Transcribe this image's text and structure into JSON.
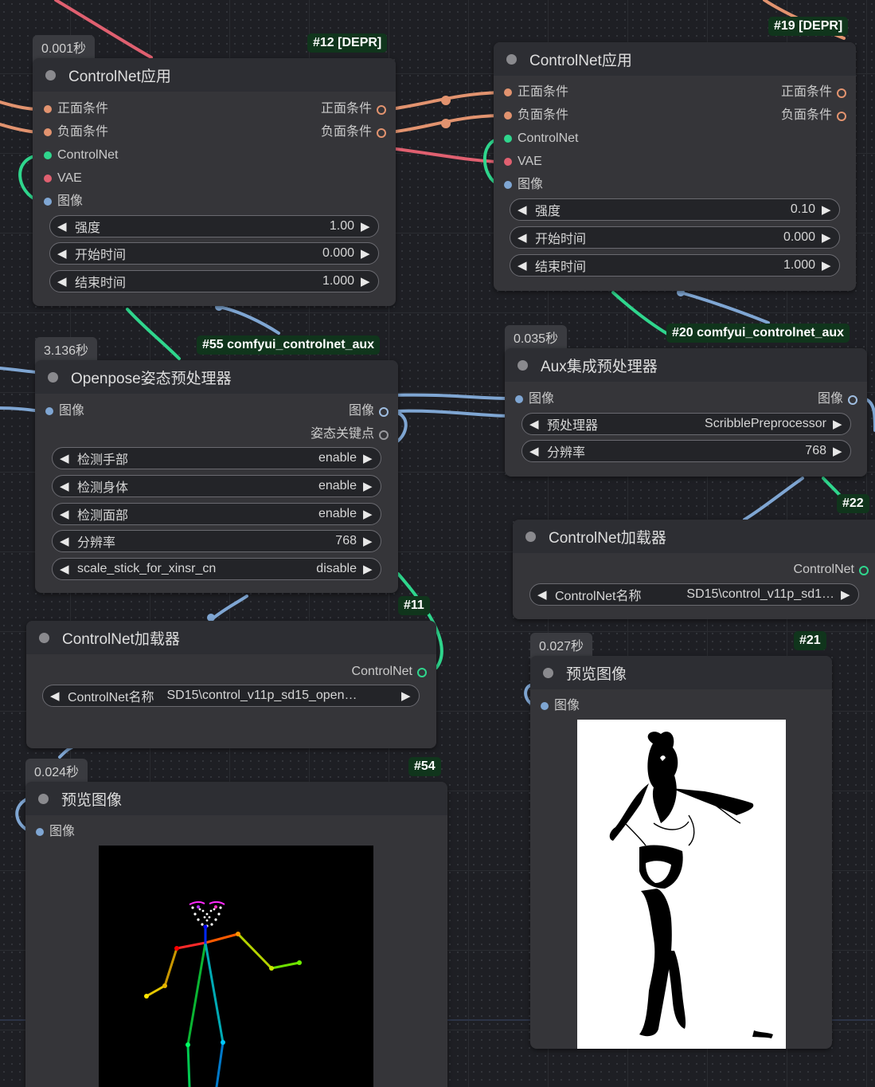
{
  "colors": {
    "canvas": "#1e1f24",
    "node_body": "#353539",
    "node_title": "#2d2e33",
    "badge_bg": "#10351c",
    "wire_cond": "#e2936f",
    "wire_cnet": "#2fd68d",
    "wire_vae": "#e06070",
    "wire_image": "#7fa6d3"
  },
  "nodes": {
    "n12": {
      "time": "0.001秒",
      "badge": "#12 [DEPR]",
      "title": "ControlNet应用",
      "inputs": [
        "正面条件",
        "负面条件",
        "ControlNet",
        "VAE",
        "图像"
      ],
      "outputs": [
        "正面条件",
        "负面条件"
      ],
      "widgets": [
        {
          "label": "强度",
          "value": "1.00"
        },
        {
          "label": "开始时间",
          "value": "0.000"
        },
        {
          "label": "结束时间",
          "value": "1.000"
        }
      ]
    },
    "n19": {
      "badge": "#19 [DEPR]",
      "title": "ControlNet应用",
      "inputs": [
        "正面条件",
        "负面条件",
        "ControlNet",
        "VAE",
        "图像"
      ],
      "outputs": [
        "正面条件",
        "负面条件"
      ],
      "widgets": [
        {
          "label": "强度",
          "value": "0.10"
        },
        {
          "label": "开始时间",
          "value": "0.000"
        },
        {
          "label": "结束时间",
          "value": "1.000"
        }
      ]
    },
    "n55": {
      "time": "3.136秒",
      "badge": "#55 comfyui_controlnet_aux",
      "title": "Openpose姿态预处理器",
      "inputs": [
        "图像"
      ],
      "outputs": [
        "图像",
        "姿态关键点"
      ],
      "widgets": [
        {
          "label": "检测手部",
          "value": "enable"
        },
        {
          "label": "检测身体",
          "value": "enable"
        },
        {
          "label": "检测面部",
          "value": "enable"
        },
        {
          "label": "分辨率",
          "value": "768"
        },
        {
          "label": "scale_stick_for_xinsr_cn",
          "value": "disable"
        }
      ]
    },
    "n20": {
      "time": "0.035秒",
      "badge": "#20 comfyui_controlnet_aux",
      "title": "Aux集成预处理器",
      "inputs": [
        "图像"
      ],
      "outputs": [
        "图像"
      ],
      "widgets": [
        {
          "label": "预处理器",
          "value": "ScribblePreprocessor"
        },
        {
          "label": "分辨率",
          "value": "768"
        }
      ]
    },
    "n22": {
      "badge": "#22",
      "title": "ControlNet加载器",
      "outputs": [
        "ControlNet"
      ],
      "widgets": [
        {
          "label": "ControlNet名称",
          "value": "SD15\\control_v11p_sd1…"
        }
      ]
    },
    "n11": {
      "badge": "#11",
      "title": "ControlNet加载器",
      "outputs": [
        "ControlNet"
      ],
      "widgets": [
        {
          "label": "ControlNet名称",
          "value": "SD15\\control_v11p_sd15_open…"
        }
      ]
    },
    "n21": {
      "time": "0.027秒",
      "badge": "#21",
      "title": "预览图像",
      "inputs": [
        "图像"
      ]
    },
    "n54": {
      "time": "0.024秒",
      "badge": "#54",
      "title": "预览图像",
      "inputs": [
        "图像"
      ]
    }
  },
  "icons": {
    "arrow_left": "◀",
    "arrow_right": "▶",
    "node_status": "status-dot-icon"
  }
}
